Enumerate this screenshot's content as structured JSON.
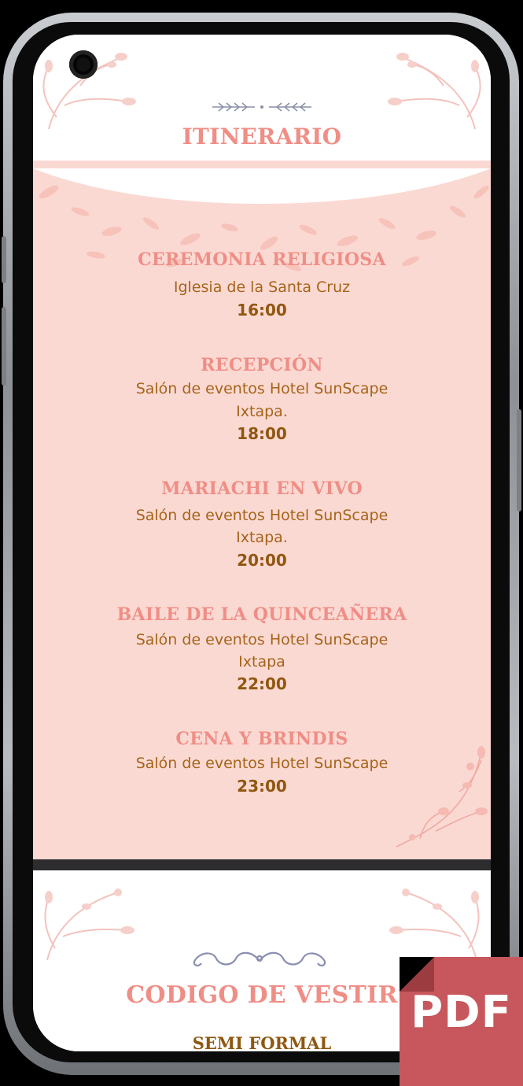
{
  "header": {
    "title": "ITINERARIO"
  },
  "events": [
    {
      "title": "CEREMONIA RELIGIOSA",
      "place_line1": "Iglesia de la Santa Cruz",
      "place_line2": "",
      "time": "16:00"
    },
    {
      "title": "RECEPCIÓN",
      "place_line1": "Salón de eventos Hotel SunScape",
      "place_line2": "Ixtapa.",
      "time": "18:00"
    },
    {
      "title": "MARIACHI EN VIVO",
      "place_line1": "Salón de eventos Hotel SunScape",
      "place_line2": "Ixtapa.",
      "time": "20:00"
    },
    {
      "title": "BAILE DE LA QUINCEAÑERA",
      "place_line1": "Salón de eventos Hotel SunScape",
      "place_line2": "Ixtapa",
      "time": "22:00"
    },
    {
      "title": "CENA Y BRINDIS",
      "place_line1": "Salón de eventos Hotel SunScape",
      "place_line2": "",
      "time": "23:00"
    }
  ],
  "dress_code": {
    "title": "CODIGO DE VESTIR",
    "value": "SEMI FORMAL"
  },
  "badge": {
    "label": "PDF"
  },
  "colors": {
    "pink_bg": "#fbd9d3",
    "title_pink": "#ef8e86",
    "text_brown": "#a5641a",
    "time_brown": "#8f5710",
    "pdf_red": "#c7575c"
  }
}
